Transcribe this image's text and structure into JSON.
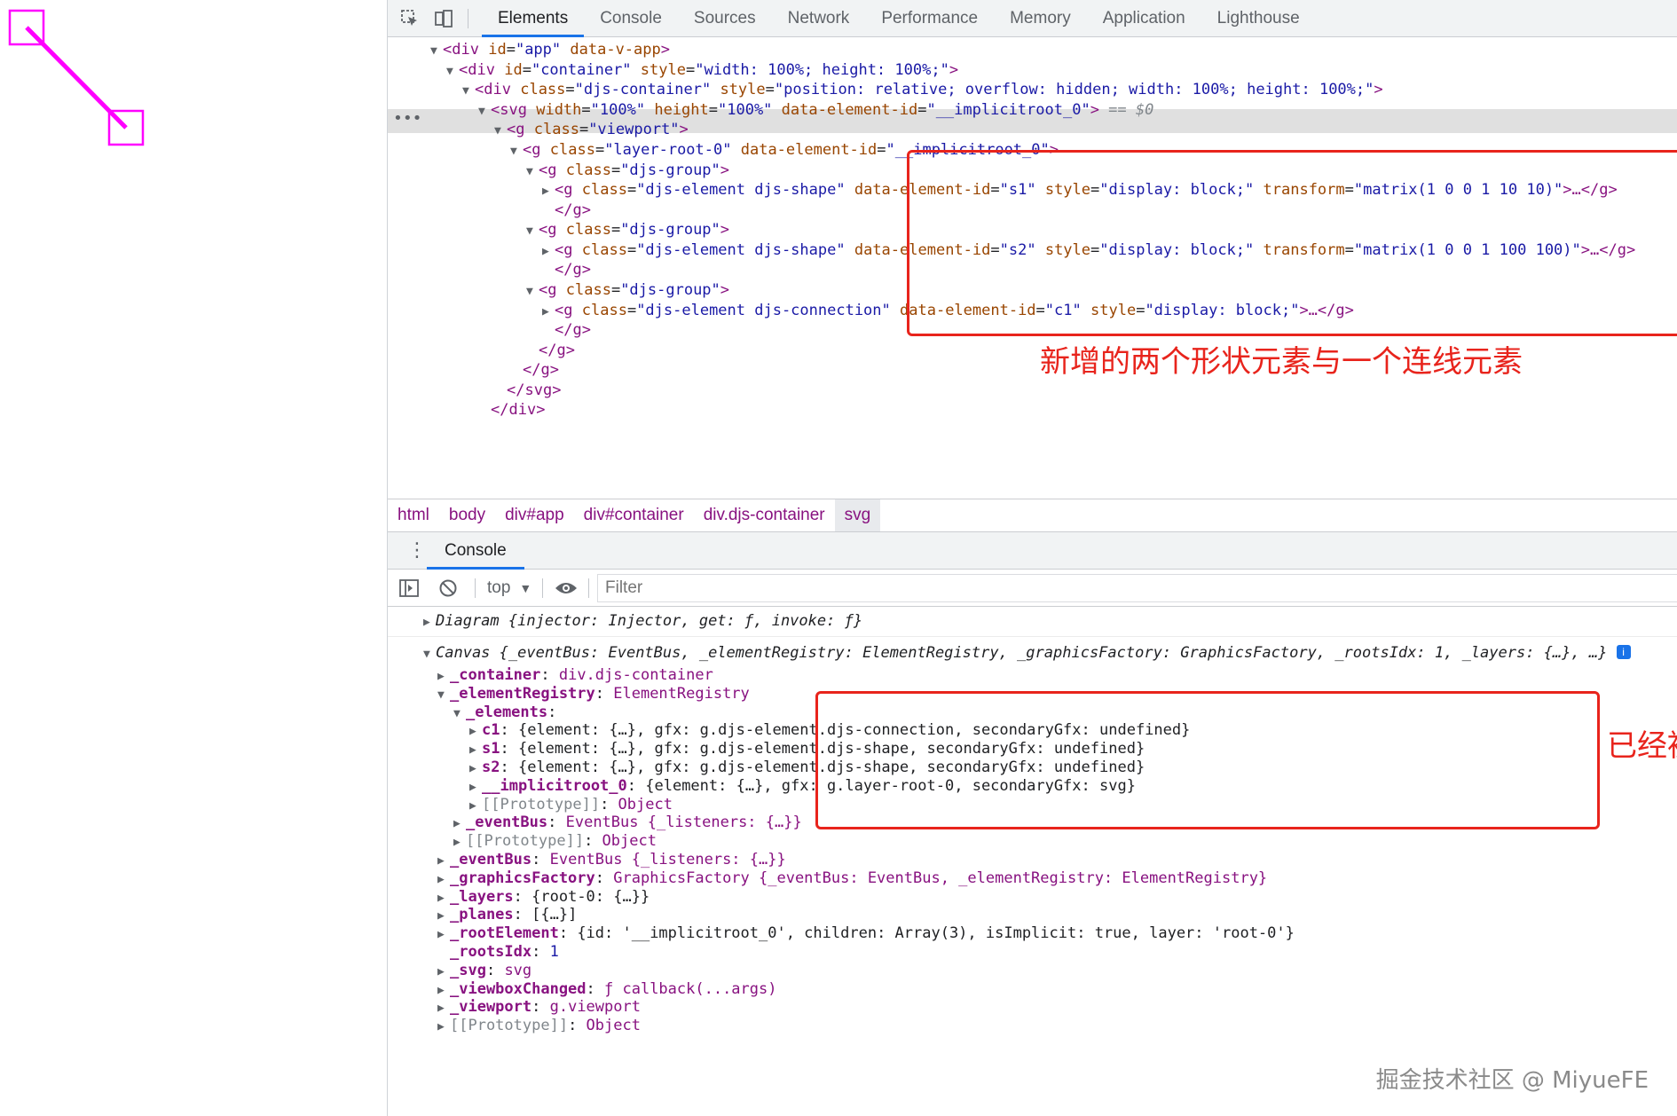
{
  "colors": {
    "accent": "#1a73e8",
    "annotation": "#e8241c",
    "magenta": "#ff00ff",
    "tag": "#881280",
    "attr_name": "#994500",
    "attr_value": "#1a1aa6"
  },
  "toolbar": {
    "inspect_icon": "element-picker-icon",
    "device_icon": "device-toolbar-icon",
    "tabs": [
      "Elements",
      "Console",
      "Sources",
      "Network",
      "Performance",
      "Memory",
      "Application",
      "Lighthouse"
    ],
    "active_tab": "Elements"
  },
  "elements_tree": {
    "lines": [
      {
        "open": "<",
        "tag": "div",
        "attrs": [
          [
            "id",
            "\"app\""
          ],
          [
            "data-v-app",
            ""
          ]
        ],
        "close": ">"
      },
      {
        "open": "<",
        "tag": "div",
        "attrs": [
          [
            "id",
            "\"container\""
          ],
          [
            "style",
            "\"width: 100%; height: 100%;\""
          ]
        ],
        "close": ">"
      },
      {
        "open": "<",
        "tag": "div",
        "attrs": [
          [
            "class",
            "\"djs-container\""
          ],
          [
            "style",
            "\"position: relative; overflow: hidden; width: 100%; height: 100%;\""
          ]
        ],
        "close": ">"
      },
      {
        "open": "<",
        "tag": "svg",
        "attrs": [
          [
            "width",
            "\"100%\""
          ],
          [
            "height",
            "\"100%\""
          ],
          [
            "data-element-id",
            "\"__implicitroot_0\""
          ]
        ],
        "close": ">",
        "suffix": " == $0"
      },
      {
        "open": "<",
        "tag": "g",
        "attrs": [
          [
            "class",
            "\"viewport\""
          ]
        ],
        "close": ">"
      },
      {
        "open": "<",
        "tag": "g",
        "attrs": [
          [
            "class",
            "\"layer-root-0\""
          ],
          [
            "data-element-id",
            "\"__implicitroot_0\""
          ]
        ],
        "close": ">"
      },
      {
        "open": "<",
        "tag": "g",
        "attrs": [
          [
            "class",
            "\"djs-group\""
          ]
        ],
        "close": ">"
      },
      {
        "open": "<",
        "tag": "g",
        "attrs": [
          [
            "class",
            "\"djs-element djs-shape\""
          ],
          [
            "data-element-id",
            "\"s1\""
          ],
          [
            "style",
            "\"display: block;\""
          ],
          [
            "transform",
            "\"matrix(1 0 0 1 10 10)\""
          ]
        ],
        "close": ">…</g>"
      },
      {
        "open": "</",
        "tag": "g",
        "attrs": [],
        "close": ">"
      },
      {
        "open": "<",
        "tag": "g",
        "attrs": [
          [
            "class",
            "\"djs-group\""
          ]
        ],
        "close": ">"
      },
      {
        "open": "<",
        "tag": "g",
        "attrs": [
          [
            "class",
            "\"djs-element djs-shape\""
          ],
          [
            "data-element-id",
            "\"s2\""
          ],
          [
            "style",
            "\"display: block;\""
          ],
          [
            "transform",
            "\"matrix(1 0 0 1 100 100)\""
          ]
        ],
        "close": ">…</g>"
      },
      {
        "open": "</",
        "tag": "g",
        "attrs": [],
        "close": ">"
      },
      {
        "open": "<",
        "tag": "g",
        "attrs": [
          [
            "class",
            "\"djs-group\""
          ]
        ],
        "close": ">"
      },
      {
        "open": "<",
        "tag": "g",
        "attrs": [
          [
            "class",
            "\"djs-element djs-connection\""
          ],
          [
            "data-element-id",
            "\"c1\""
          ],
          [
            "style",
            "\"display: block;\""
          ]
        ],
        "close": ">…</g>"
      },
      {
        "open": "</",
        "tag": "g",
        "attrs": [],
        "close": ">"
      },
      {
        "open": "</",
        "tag": "g",
        "attrs": [],
        "close": ">"
      },
      {
        "open": "</",
        "tag": "g",
        "attrs": [],
        "close": ">"
      },
      {
        "open": "</",
        "tag": "svg",
        "attrs": [],
        "close": ">"
      },
      {
        "open": "</",
        "tag": "div",
        "attrs": [],
        "close": ">"
      }
    ],
    "dots": "•••",
    "annotation": "新增的两个形状元素与一个连线元素"
  },
  "breadcrumb": [
    "html",
    "body",
    "div#app",
    "div#container",
    "div.djs-container",
    "svg"
  ],
  "drawer": {
    "tab": "Console"
  },
  "console_toolbar": {
    "context": "top",
    "filter_placeholder": "Filter"
  },
  "console": {
    "diagram_line": {
      "name": "Diagram",
      "body": "{injector: Injector, get: ƒ, invoke: ƒ}"
    },
    "canvas_line": {
      "name": "Canvas",
      "body": "{_eventBus: EventBus, _elementRegistry: ElementRegistry, _graphicsFactory: GraphicsFactory, _rootsIdx: 1, _layers: {…}, …}",
      "badge": "i"
    },
    "props": [
      {
        "key": "_container",
        "val": "div.djs-container"
      },
      {
        "key": "_elementRegistry",
        "val": "ElementRegistry"
      },
      {
        "key": "_elements",
        "val": ""
      },
      {
        "key": "c1",
        "val": "{element: {…}, gfx: g.djs-element.djs-connection, secondaryGfx: undefined}"
      },
      {
        "key": "s1",
        "val": "{element: {…}, gfx: g.djs-element.djs-shape, secondaryGfx: undefined}"
      },
      {
        "key": "s2",
        "val": "{element: {…}, gfx: g.djs-element.djs-shape, secondaryGfx: undefined}"
      },
      {
        "key": "__implicitroot_0",
        "val": "{element: {…}, gfx: g.layer-root-0, secondaryGfx: svg}"
      },
      {
        "key": "[[Prototype]]",
        "val": "Object"
      },
      {
        "key": "_eventBus",
        "val": "EventBus {_listeners: {…}}"
      },
      {
        "key": "[[Prototype]]",
        "val": "Object"
      },
      {
        "key": "_eventBus",
        "val": "EventBus {_listeners: {…}}"
      },
      {
        "key": "_graphicsFactory",
        "val": "GraphicsFactory {_eventBus: EventBus, _elementRegistry: ElementRegistry}"
      },
      {
        "key": "_layers",
        "val": "{root-0: {…}}"
      },
      {
        "key": "_planes",
        "val": "[{…}]"
      },
      {
        "key": "_rootElement",
        "val": "{id: '__implicitroot_0', children: Array(3), isImplicit: true, layer: 'root-0'}"
      },
      {
        "key": "_rootsIdx",
        "val": "1"
      },
      {
        "key": "_svg",
        "val": "svg"
      },
      {
        "key": "_viewboxChanged",
        "val": "ƒ callback(...args)"
      },
      {
        "key": "_viewport",
        "val": "g.viewport"
      },
      {
        "key": "[[Prototype]]",
        "val": "Object"
      }
    ],
    "annotation": "已经被注册到 ElementRegistry 中"
  },
  "watermark": "掘金技术社区 @ MiyueFE"
}
